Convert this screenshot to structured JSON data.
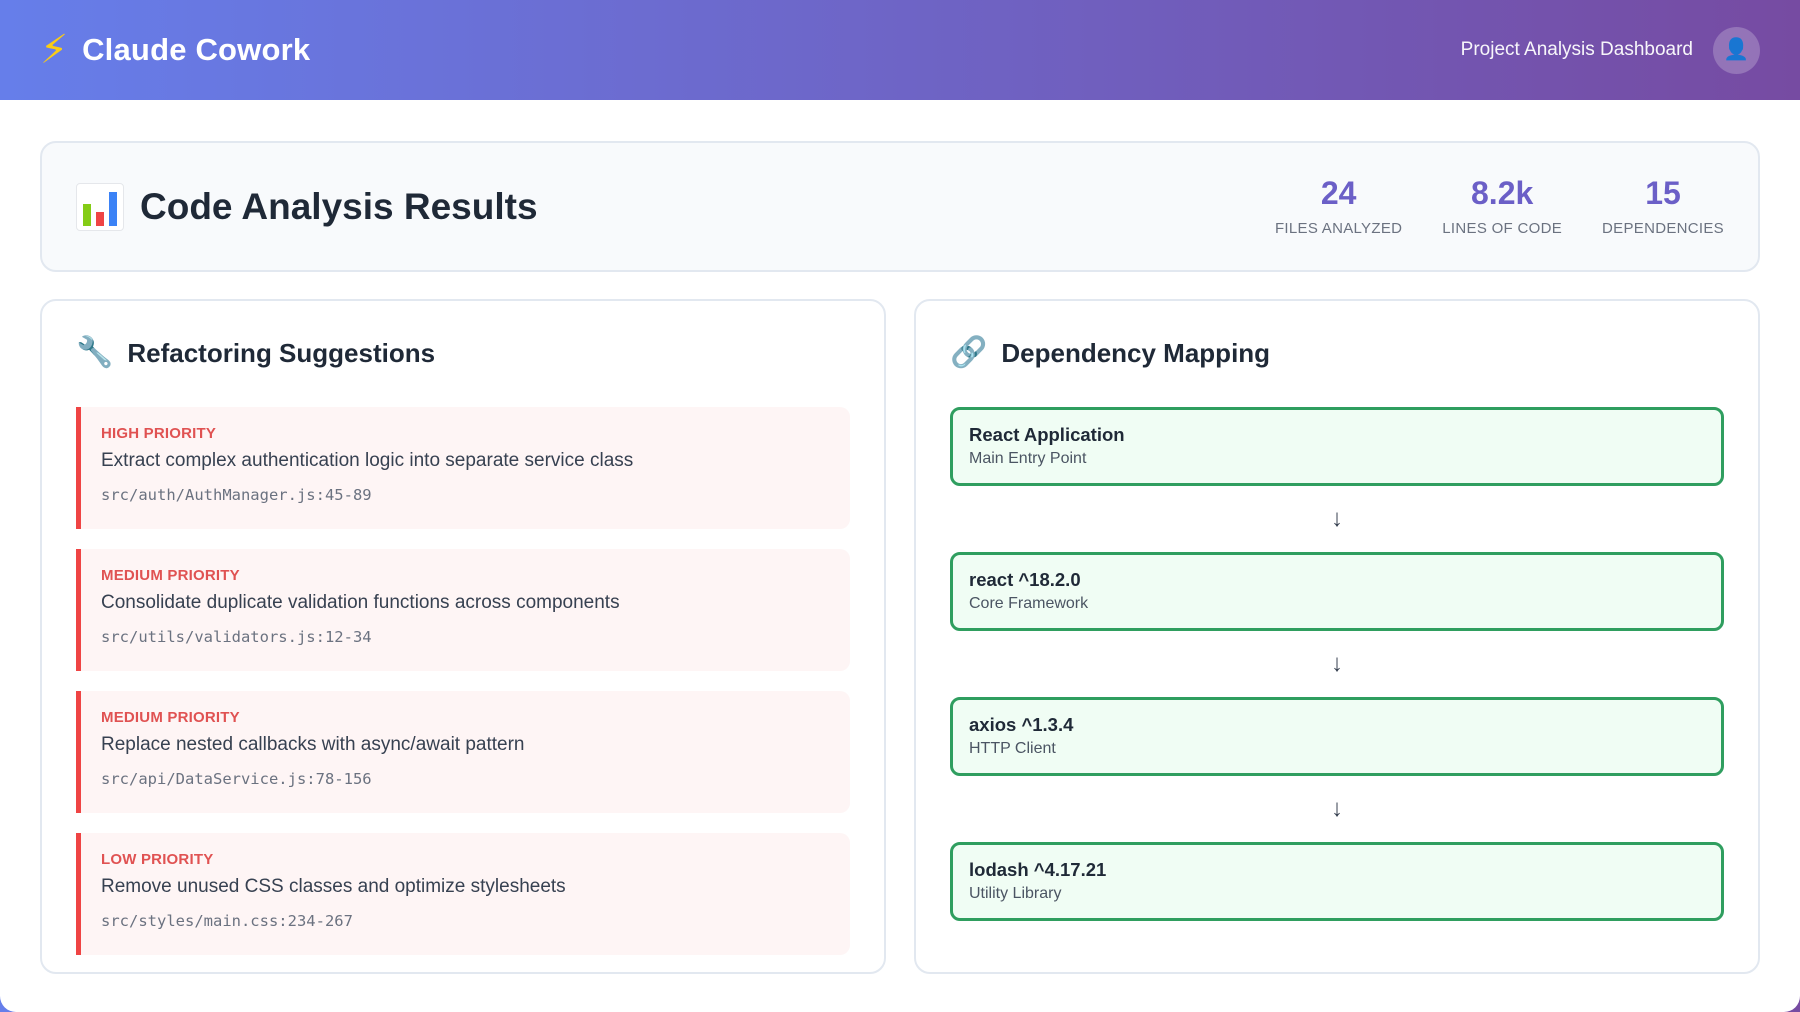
{
  "header": {
    "brand_icon": "lightning-icon",
    "title": "Claude Cowork",
    "subtitle": "Project Analysis Dashboard",
    "avatar_icon": "user-icon"
  },
  "summary": {
    "icon": "bar-chart-icon",
    "title": "Code Analysis Results",
    "stats": [
      {
        "value": "24",
        "label": "FILES ANALYZED"
      },
      {
        "value": "8.2k",
        "label": "LINES OF CODE"
      },
      {
        "value": "15",
        "label": "DEPENDENCIES"
      }
    ]
  },
  "refactoring": {
    "icon": "wrench-icon",
    "title": "Refactoring Suggestions",
    "items": [
      {
        "priority": "HIGH PRIORITY",
        "text": "Extract complex authentication logic into separate service class",
        "file": "src/auth/AuthManager.js:45-89"
      },
      {
        "priority": "MEDIUM PRIORITY",
        "text": "Consolidate duplicate validation functions across components",
        "file": "src/utils/validators.js:12-34"
      },
      {
        "priority": "MEDIUM PRIORITY",
        "text": "Replace nested callbacks with async/await pattern",
        "file": "src/api/DataService.js:78-156"
      },
      {
        "priority": "LOW PRIORITY",
        "text": "Remove unused CSS classes and optimize stylesheets",
        "file": "src/styles/main.css:234-267"
      }
    ]
  },
  "dependencies": {
    "icon": "link-icon",
    "title": "Dependency Mapping",
    "arrow": "↓",
    "nodes": [
      {
        "name": "React Application",
        "desc": "Main Entry Point"
      },
      {
        "name": "react ^18.2.0",
        "desc": "Core Framework"
      },
      {
        "name": "axios ^1.3.4",
        "desc": "HTTP Client"
      },
      {
        "name": "lodash ^4.17.21",
        "desc": "Utility Library"
      }
    ]
  },
  "colors": {
    "gradient_start": "#667eea",
    "gradient_end": "#764ba2",
    "accent": "#6b5fc7",
    "priority_red": "#ef4444",
    "dep_green": "#2f9e5f"
  }
}
